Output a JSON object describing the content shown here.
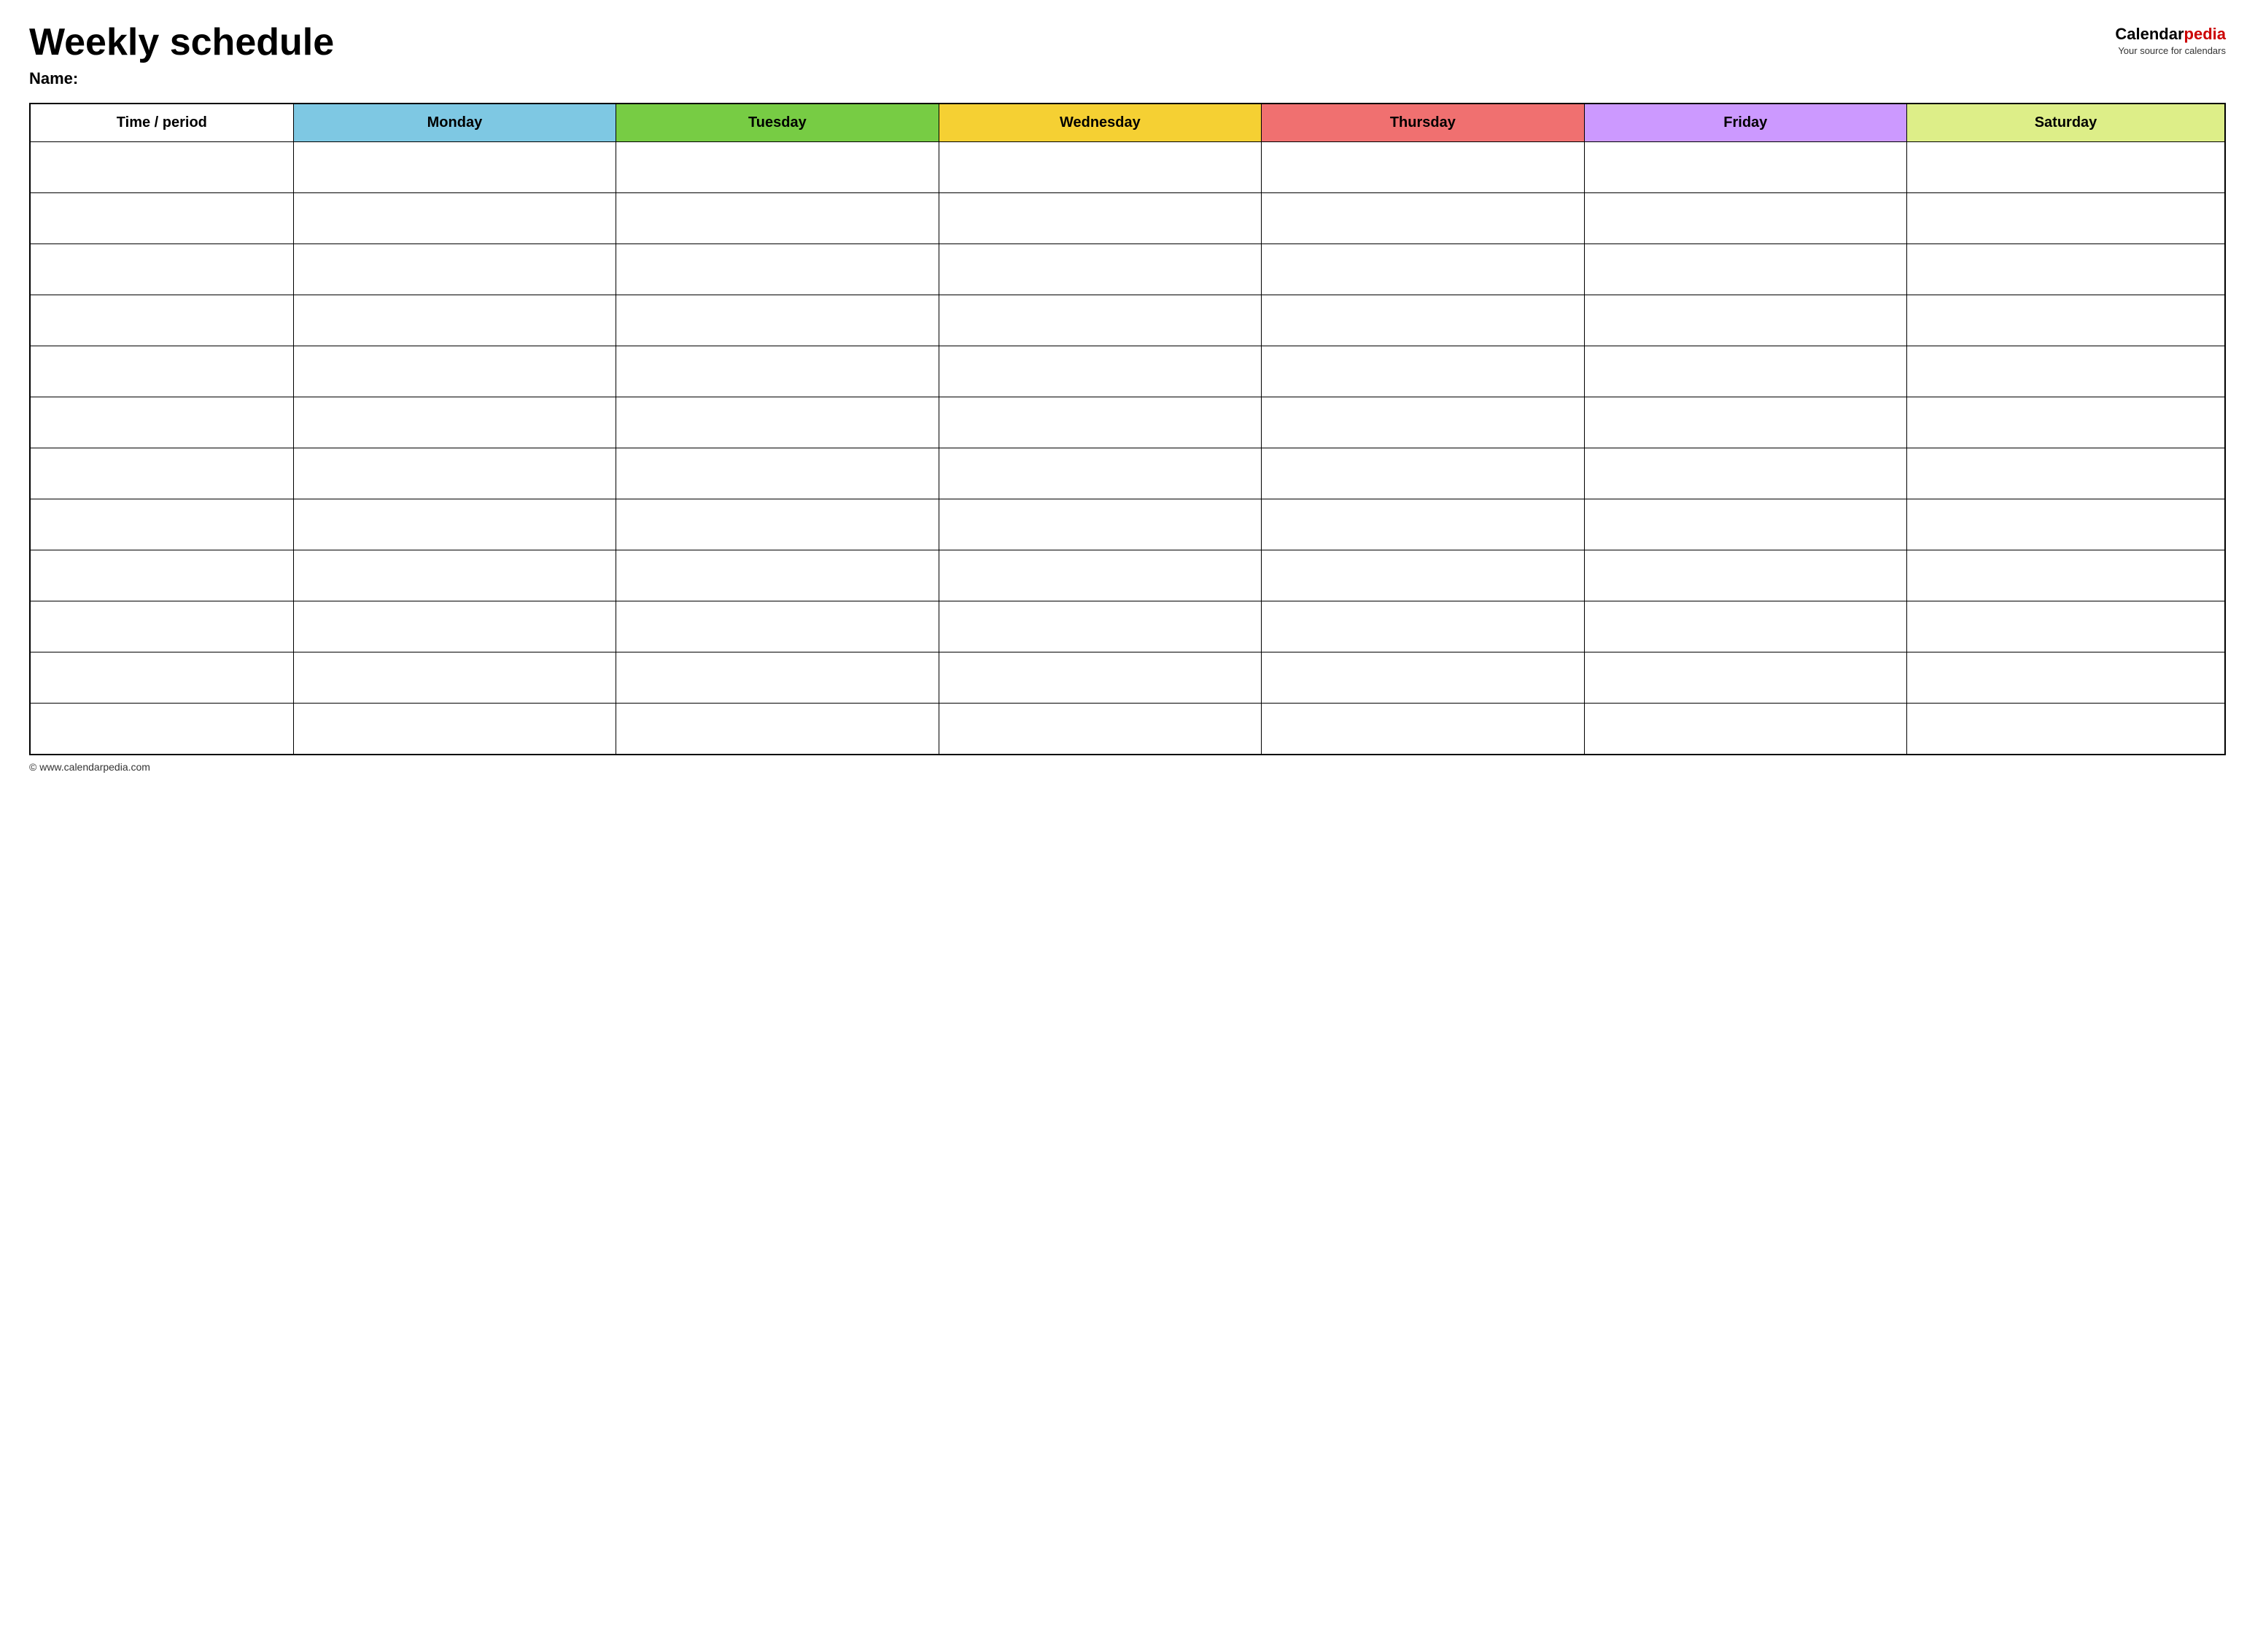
{
  "header": {
    "title": "Weekly schedule",
    "name_label": "Name:",
    "logo": {
      "calendar_part": "Calendar",
      "pedia_part": "pedia",
      "tagline": "Your source for calendars"
    }
  },
  "table": {
    "columns": [
      {
        "id": "time",
        "label": "Time / period",
        "color": "#ffffff",
        "class": "col-time"
      },
      {
        "id": "monday",
        "label": "Monday",
        "color": "#7ec8e3",
        "class": "col-monday"
      },
      {
        "id": "tuesday",
        "label": "Tuesday",
        "color": "#77cc44",
        "class": "col-tuesday"
      },
      {
        "id": "wednesday",
        "label": "Wednesday",
        "color": "#f5d033",
        "class": "col-wednesday"
      },
      {
        "id": "thursday",
        "label": "Thursday",
        "color": "#f07070",
        "class": "col-thursday"
      },
      {
        "id": "friday",
        "label": "Friday",
        "color": "#cc99ff",
        "class": "col-friday"
      },
      {
        "id": "saturday",
        "label": "Saturday",
        "color": "#ddee88",
        "class": "col-saturday"
      }
    ],
    "row_count": 12
  },
  "footer": {
    "url": "© www.calendarpedia.com"
  }
}
